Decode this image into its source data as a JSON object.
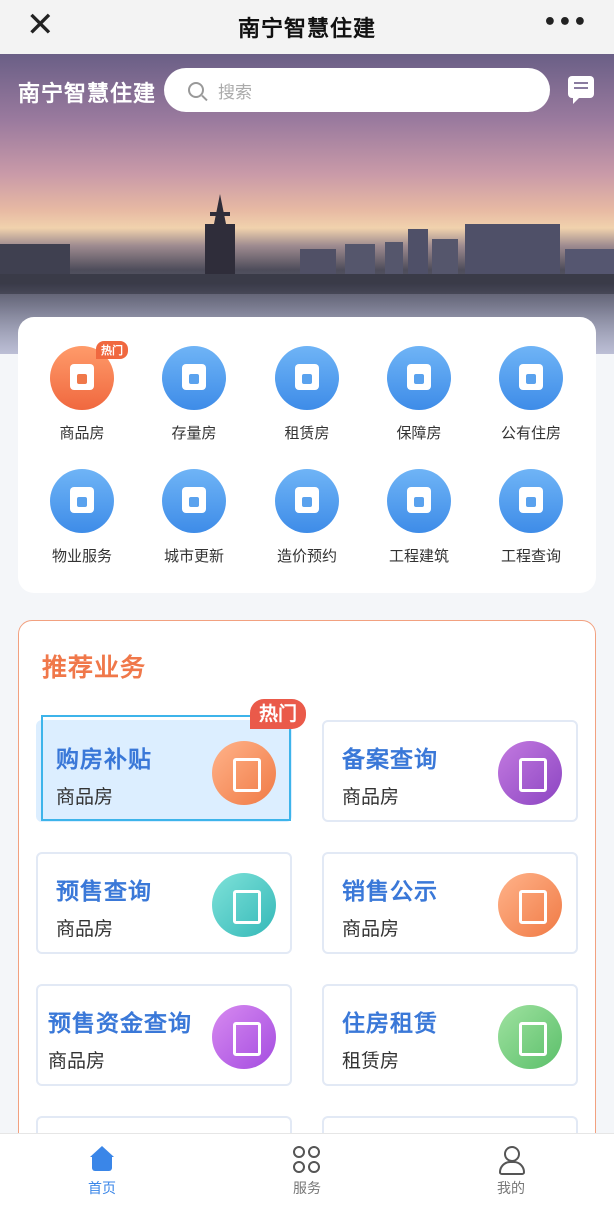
{
  "topbar": {
    "close": "✕",
    "title": "南宁智慧住建",
    "more": "•••"
  },
  "banner": {
    "brand": "南宁智慧住建",
    "search_placeholder": "搜索"
  },
  "shortcuts": {
    "hot_tag": "热门",
    "items": [
      {
        "label": "商品房",
        "icon": "house-bag-icon"
      },
      {
        "label": "存量房",
        "icon": "house-icon"
      },
      {
        "label": "租赁房",
        "icon": "house-key-icon"
      },
      {
        "label": "保障房",
        "icon": "shield-house-icon"
      },
      {
        "label": "公有住房",
        "icon": "house-hand-icon"
      },
      {
        "label": "物业服务",
        "icon": "house-gear-icon"
      },
      {
        "label": "城市更新",
        "icon": "paint-roller-icon"
      },
      {
        "label": "造价预约",
        "icon": "folder-icon"
      },
      {
        "label": "工程建筑",
        "icon": "building-icon"
      },
      {
        "label": "工程查询",
        "icon": "search-list-icon"
      }
    ]
  },
  "recommend": {
    "title": "推荐业务",
    "hot_tag": "热门",
    "items": [
      {
        "name": "购房补贴",
        "sub": "商品房"
      },
      {
        "name": "备案查询",
        "sub": "商品房"
      },
      {
        "name": "预售查询",
        "sub": "商品房"
      },
      {
        "name": "销售公示",
        "sub": "商品房"
      },
      {
        "name": "预售资金查询",
        "sub": "商品房"
      },
      {
        "name": "住房租赁",
        "sub": "租赁房"
      }
    ]
  },
  "tabbar": {
    "home": "首页",
    "service": "服务",
    "mine": "我的"
  },
  "colors": {
    "accent": "#3a86e8",
    "recommend_title": "#f0784a",
    "hot": "#ea5a4a"
  }
}
